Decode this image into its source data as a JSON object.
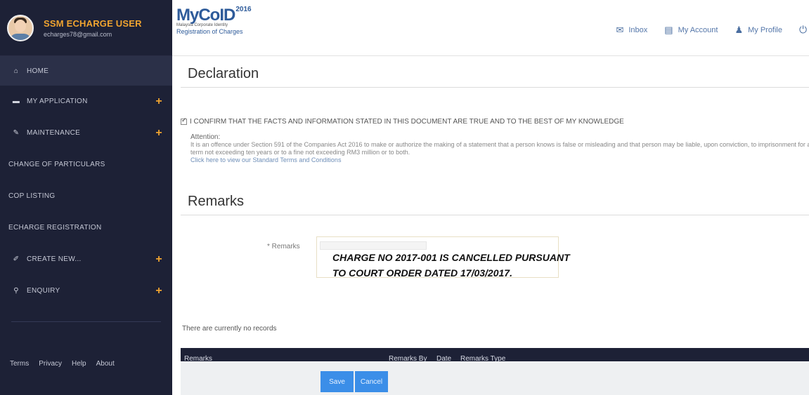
{
  "user": {
    "name": "SSM ECHARGE USER",
    "email": "echarges78@gmail.com"
  },
  "sidebar": {
    "items": [
      {
        "label": "HOME",
        "icon": "home-icon",
        "glyph": "⌂",
        "has_plus": false
      },
      {
        "label": "MY APPLICATION",
        "icon": "briefcase-icon",
        "glyph": "▬",
        "has_plus": true
      },
      {
        "label": "MAINTENANCE",
        "icon": "wrench-icon",
        "glyph": "✎",
        "has_plus": true
      },
      {
        "label": "CHANGE OF PARTICULARS",
        "icon": "",
        "glyph": "",
        "has_plus": false
      },
      {
        "label": "COP LISTING",
        "icon": "",
        "glyph": "",
        "has_plus": false
      },
      {
        "label": "ECHARGE REGISTRATION",
        "icon": "",
        "glyph": "",
        "has_plus": false
      },
      {
        "label": "CREATE NEW...",
        "icon": "edit-icon",
        "glyph": "✐",
        "has_plus": true
      },
      {
        "label": "ENQUIRY",
        "icon": "search-icon",
        "glyph": "🔍",
        "has_plus": true
      }
    ],
    "plus_glyph": "+",
    "footer_links": [
      "Terms",
      "Privacy",
      "Help",
      "About"
    ]
  },
  "header": {
    "logo": {
      "my": "My",
      "cod": "CoID",
      "year": "2016",
      "tagline": "Malaysia Corporate Identity",
      "subtitle": "Registration of Charges"
    },
    "menu": [
      {
        "label": "Inbox",
        "icon": "envelope-icon"
      },
      {
        "label": "My Account",
        "icon": "card-icon"
      },
      {
        "label": "My Profile",
        "icon": "user-icon"
      }
    ]
  },
  "declaration": {
    "title": "Declaration",
    "confirm_text": "I CONFIRM THAT THE FACTS AND INFORMATION STATED IN THIS DOCUMENT ARE TRUE AND TO THE BEST OF MY KNOWLEDGE",
    "attention_title": "Attention:",
    "attention_text": "It is an offence under Section 591 of the Companies Act 2016 to make or authorize the making of a statement that a person knows is false or misleading and that person may be liable, upon conviction, to imprisonment for a term not exceeding ten years or to a fine not exceeding RM3 million or to both.",
    "terms_link": "Click here to view our Standard Terms and Conditions"
  },
  "remarks": {
    "title": "Remarks",
    "field_label": "* Remarks",
    "value_line1": "CHARGE NO 2017-001 IS CANCELLED PURSUANT",
    "value_line2": "TO COURT ORDER DATED 17/03/2017."
  },
  "table": {
    "columns": [
      "Remarks",
      "Remarks By",
      "Date",
      "Remarks Type"
    ],
    "empty_text": "There are currently no records"
  },
  "actions": {
    "save": "Save",
    "cancel": "Cancel"
  },
  "colors": {
    "sidebar_bg": "#1d2136",
    "accent_orange": "#f0a430",
    "button_blue": "#3b8ee8",
    "link_blue": "#5577aa"
  }
}
